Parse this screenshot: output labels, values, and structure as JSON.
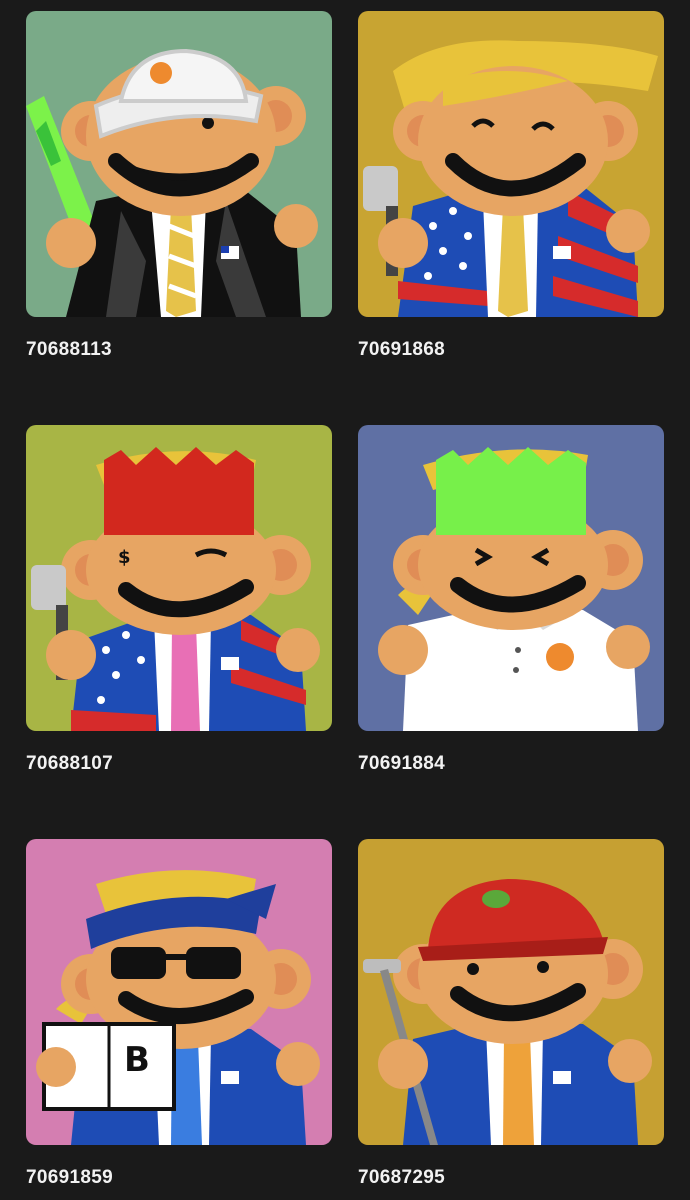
{
  "items": [
    {
      "id": "70688113",
      "bg": "#7aaa88",
      "outfit": "black-suit",
      "tie": "#e6c24a",
      "hat": "white-bucket-hat",
      "prop": "green-lightsaber"
    },
    {
      "id": "70691868",
      "bg": "#c8a432",
      "outfit": "flag-suit",
      "tie": "#e6c24a",
      "hat": "yellow-hair",
      "prop": "spatula"
    },
    {
      "id": "70688107",
      "bg": "#a8b545",
      "outfit": "flag-suit",
      "tie": "#e86fb5",
      "hat": "red-crown",
      "prop": "spatula"
    },
    {
      "id": "70691884",
      "bg": "#5f70a4",
      "outfit": "white-polo",
      "tie": "",
      "hat": "green-crown",
      "prop": "none"
    },
    {
      "id": "70691859",
      "bg": "#d47eb1",
      "outfit": "blue-suit",
      "tie": "#3a7de0",
      "hat": "bandana",
      "prop": "bitcoin-book"
    },
    {
      "id": "70687295",
      "bg": "#c6a032",
      "outfit": "blue-suit",
      "tie": "#eea23a",
      "hat": "red-cap",
      "prop": "golf-club"
    }
  ]
}
